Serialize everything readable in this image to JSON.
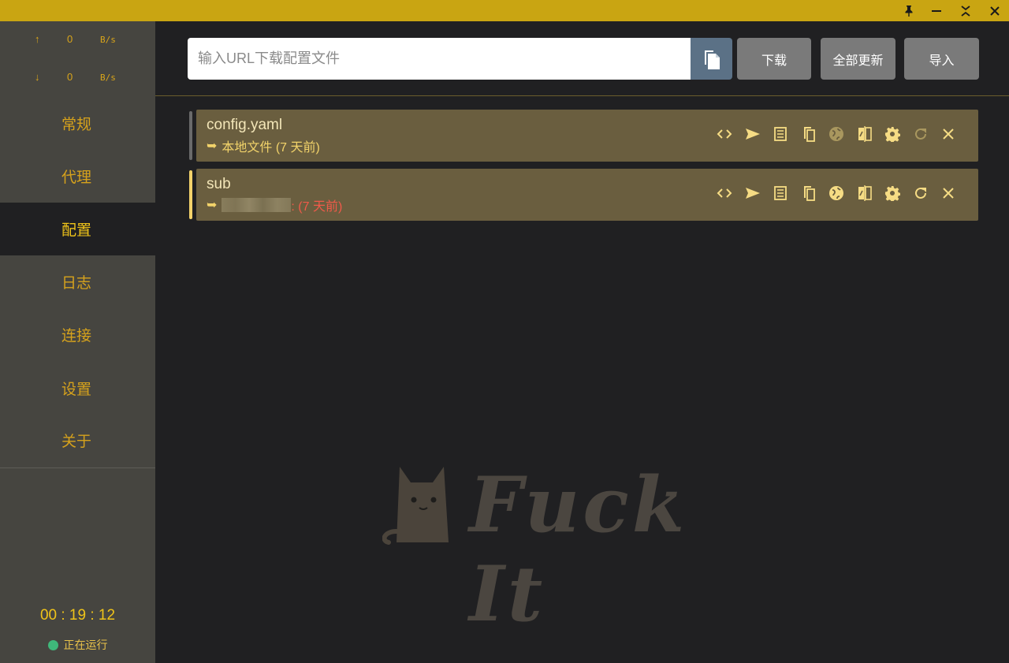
{
  "titlebar": {
    "pin_icon": "pin-icon",
    "minimize_icon": "minimize-icon",
    "collapse_icon": "collapse-icon",
    "close_icon": "close-icon",
    "color": "#c9a512"
  },
  "sidebar": {
    "upload": {
      "arrow": "↑",
      "value": "0",
      "unit": "B/s"
    },
    "download": {
      "arrow": "↓",
      "value": "0",
      "unit": "B/s"
    },
    "nav": [
      {
        "label": "常规"
      },
      {
        "label": "代理"
      },
      {
        "label": "配置",
        "active": true
      },
      {
        "label": "日志"
      },
      {
        "label": "连接"
      },
      {
        "label": "设置"
      },
      {
        "label": "关于"
      }
    ],
    "timer": "00 : 19 : 12",
    "status": "正在运行",
    "status_color": "#3fb87a"
  },
  "toolbar": {
    "url_placeholder": "输入URL下载配置文件",
    "url_value": "",
    "paste_icon": "paste-icon",
    "download_label": "下载",
    "update_all_label": "全部更新",
    "import_label": "导入"
  },
  "profiles": [
    {
      "name": "config.yaml",
      "arrow": "➥",
      "source": "本地文件 (7 天前)",
      "selected": false,
      "actions": [
        "code-icon",
        "send-icon",
        "list-icon",
        "copy-icon",
        "globe-icon",
        "compare-icon",
        "gear-icon",
        "refresh-icon",
        "close-icon"
      ],
      "dimmed_actions": [
        "globe-icon",
        "refresh-icon"
      ]
    },
    {
      "name": "sub",
      "arrow": "➥",
      "source_redacted": true,
      "time": ": (7 天前)",
      "time_color": "#f05a4a",
      "selected": true,
      "actions": [
        "code-icon",
        "send-icon",
        "list-icon",
        "copy-icon",
        "globe-icon",
        "compare-icon",
        "gear-icon",
        "refresh-icon",
        "close-icon"
      ],
      "dimmed_actions": []
    }
  ],
  "watermark": {
    "text": "Fuck It",
    "icon": "cat-icon"
  }
}
